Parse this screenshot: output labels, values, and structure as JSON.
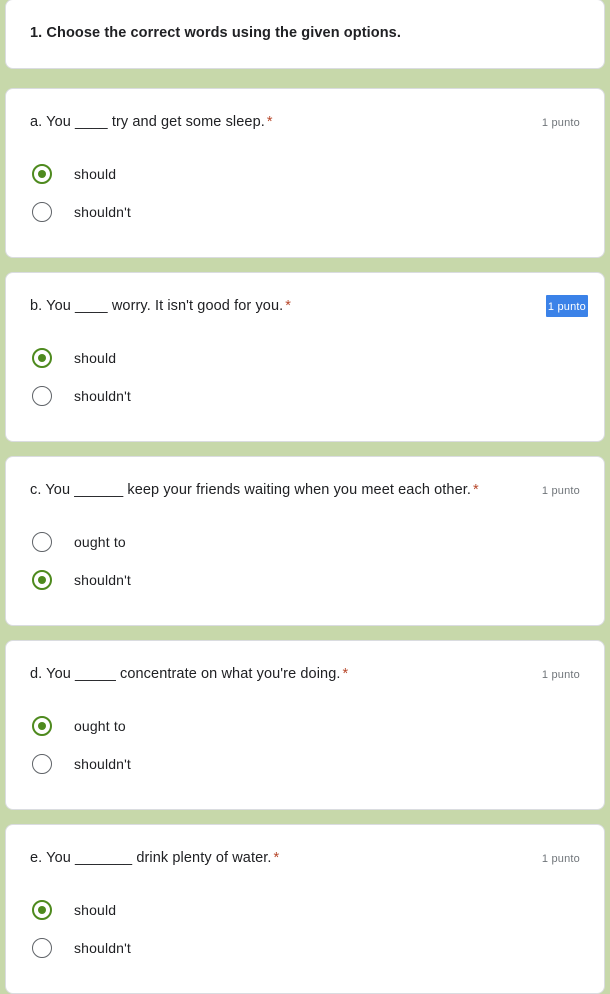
{
  "form": {
    "background_color": "#c7d8aa",
    "card_color": "#ffffff",
    "accent_color": "#4e8a1e",
    "required_marker_color": "#b7472a",
    "selection_highlight_color": "#3b82e8",
    "title": "1. Choose the correct words using the given options.",
    "required_symbol": "*",
    "questions": [
      {
        "id": "a",
        "text": "a. You ____ try and get some sleep.",
        "required": true,
        "points_label": "1 punto",
        "points_text_selected": false,
        "options": [
          {
            "label": "should",
            "selected": true
          },
          {
            "label": "shouldn't",
            "selected": false
          }
        ]
      },
      {
        "id": "b",
        "text": "b. You ____ worry. It isn't good for you.",
        "required": true,
        "points_label": "1 punto",
        "points_text_selected": true,
        "options": [
          {
            "label": "should",
            "selected": true
          },
          {
            "label": "shouldn't",
            "selected": false
          }
        ]
      },
      {
        "id": "c",
        "text": "c. You ______ keep your friends waiting when you meet each other.",
        "required": true,
        "points_label": "1 punto",
        "points_text_selected": false,
        "options": [
          {
            "label": "ought to",
            "selected": false
          },
          {
            "label": "shouldn't",
            "selected": true
          }
        ]
      },
      {
        "id": "d",
        "text": "d. You _____ concentrate on what you're doing.",
        "required": true,
        "points_label": "1 punto",
        "points_text_selected": false,
        "options": [
          {
            "label": "ought to",
            "selected": true
          },
          {
            "label": "shouldn't",
            "selected": false
          }
        ]
      },
      {
        "id": "e",
        "text": "e. You _______ drink plenty of water.",
        "required": true,
        "points_label": "1 punto",
        "points_text_selected": false,
        "options": [
          {
            "label": "should",
            "selected": true
          },
          {
            "label": "shouldn't",
            "selected": false
          }
        ]
      }
    ]
  }
}
